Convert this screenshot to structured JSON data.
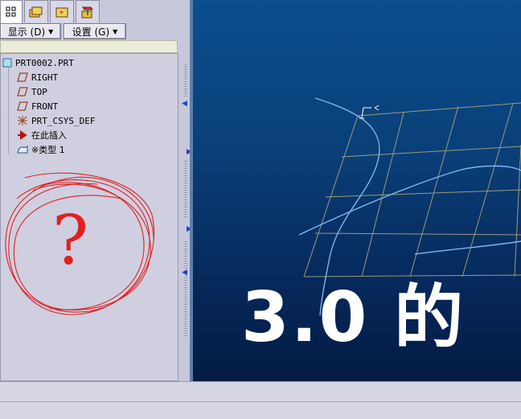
{
  "toolbar": {
    "show_label": "显示 (D)",
    "settings_label": "设置 (G)"
  },
  "tabs": [
    {
      "icon": "model-tree-icon",
      "active": true
    },
    {
      "icon": "folder-browser-icon",
      "active": false
    },
    {
      "icon": "favorites-icon",
      "active": false
    },
    {
      "icon": "tools-icon",
      "active": false
    }
  ],
  "model_tree": {
    "root": "PRT0002.PRT",
    "items": [
      {
        "label": "RIGHT",
        "icon": "datum-plane-icon"
      },
      {
        "label": "TOP",
        "icon": "datum-plane-icon"
      },
      {
        "label": "FRONT",
        "icon": "datum-plane-icon"
      },
      {
        "label": "PRT_CSYS_DEF",
        "icon": "csys-icon"
      },
      {
        "label": "在此插入",
        "icon": "insert-here-arrow-icon"
      },
      {
        "label": "※类型 1",
        "icon": "feature-icon"
      }
    ]
  },
  "annotations": {
    "question_mark": "?",
    "handwritten_text": "3.0 的"
  },
  "colors": {
    "viewport_top": "#0b4f8f",
    "viewport_bottom": "#031b43",
    "grid": "#9a9a7a",
    "curve": "#7fb6f0",
    "scribble": "#e02020",
    "handwriting": "#ffffff"
  }
}
